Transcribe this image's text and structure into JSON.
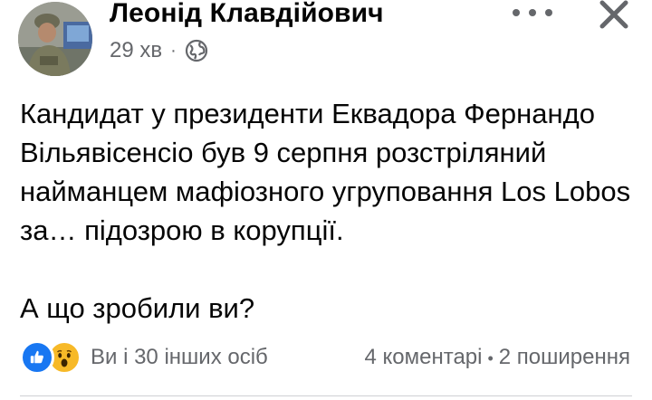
{
  "post": {
    "author_name": "Леонід Клавдійович",
    "time": "29 хв",
    "privacy_icon": "globe-icon",
    "paragraphs": [
      "Кандидат у президенти Еквадора Фернандо Вільявісенсіо був 9 серпня розстріляний найманцем мафіозного угруповання Los Lobos за… підозрою в корупції.",
      "А що зробили ви?"
    ],
    "reactions": {
      "icons": [
        "like-icon",
        "wow-icon"
      ],
      "summary": "Ви і 30 інших осіб"
    },
    "comments": "4 коментарі",
    "shares": "2 поширення"
  },
  "colors": {
    "text": "#050505",
    "secondary": "#65676b",
    "like": "#1877f2",
    "wow": "#f7b928"
  }
}
